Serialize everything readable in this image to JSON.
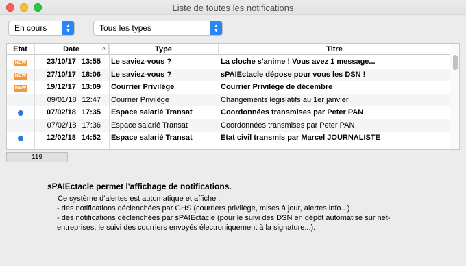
{
  "window": {
    "title": "Liste de toutes les notifications"
  },
  "filters": {
    "status": "En cours",
    "type": "Tous les types"
  },
  "table": {
    "columns": [
      "Etat",
      "Date",
      "Type",
      "Titre"
    ],
    "rows": [
      {
        "etat": "new",
        "date": "23/10/17",
        "time": "13:55",
        "type": "Le saviez-vous ?",
        "titre": "La cloche s'anime ! Vous avez 1 message...",
        "bold": true
      },
      {
        "etat": "new",
        "date": "27/10/17",
        "time": "18:06",
        "type": "Le saviez-vous ?",
        "titre": "sPAIEctacle dépose pour vous les DSN !",
        "bold": true
      },
      {
        "etat": "new",
        "date": "19/12/17",
        "time": "13:09",
        "type": "Courrier Privilège",
        "titre": "Courrier Privilège de décembre",
        "bold": true
      },
      {
        "etat": "",
        "date": "09/01/18",
        "time": "12:47",
        "type": "Courrier Privilège",
        "titre": "Changements législatifs au 1er janvier",
        "bold": false
      },
      {
        "etat": "dot",
        "date": "07/02/18",
        "time": "17:35",
        "type": "Espace salarié Transat",
        "titre": "Coordonnées transmises par Peter PAN",
        "bold": true
      },
      {
        "etat": "",
        "date": "07/02/18",
        "time": "17:36",
        "type": "Espace salarié Transat",
        "titre": "Coordonnées transmises par Peter PAN",
        "bold": false
      },
      {
        "etat": "dot",
        "date": "12/02/18",
        "time": "14:52",
        "type": "Espace salarié Transat",
        "titre": "Etat civil transmis par Marcel JOURNALISTE",
        "bold": true
      }
    ],
    "new_badge": "NEW",
    "count": "119"
  },
  "info": {
    "title": "sPAIEctacle permet l'affichage de notifications.",
    "lines": [
      "Ce système d'alertes est automatique et affiche :",
      "- des notifications déclenchées par GHS (courriers privilège, mises à jour, alertes info...)",
      "- des notifications déclenchées par sPAIEctacle (pour le suivi des DSN en dépôt automatisé sur net-",
      "entreprises, le suivi des courriers envoyés électroniquement à la signature...)."
    ]
  },
  "colors": {
    "accent": "#2c85f5",
    "new_badge": "#f29a3a",
    "dot": "#2b7be0"
  }
}
